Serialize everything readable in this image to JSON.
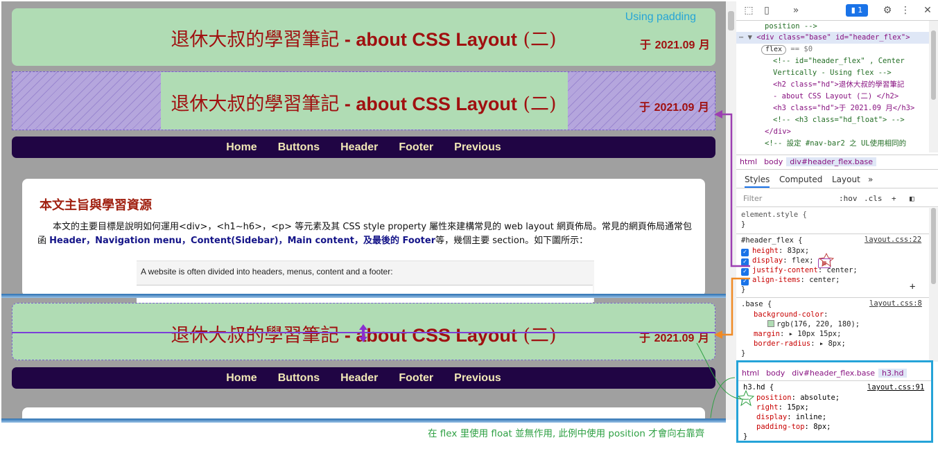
{
  "page": {
    "header1": {
      "title_zh": "退休大叔的學習筆記",
      "title_sep": " - ",
      "title_en": "about CSS Layout",
      "title_num": " (二)",
      "date_prefix": "于 ",
      "date_num": "2021.09",
      "date_suffix": " 月",
      "note": "Using padding"
    },
    "header2": {
      "title_zh": "退休大叔的學習筆記",
      "title_sep": " - ",
      "title_en": "about CSS Layout",
      "title_num": " (二)",
      "date_prefix": "于 ",
      "date_num": "2021.09",
      "date_suffix": " 月"
    },
    "header3": {
      "title_zh": "退休大叔的學習筆記",
      "title_sep": " - ",
      "title_en": "about CSS Layout",
      "title_num": " (二)",
      "date_prefix": "于 ",
      "date_num": "2021.09",
      "date_suffix": " 月"
    },
    "nav": [
      "Home",
      "Buttons",
      "Header",
      "Footer",
      "Previous"
    ],
    "card": {
      "heading": "本文主旨與學習資源",
      "para_1": "本文的主要目標是說明如何運用<div>，<h1~h6>，<p> 等元素及其 CSS style property 屬性來建構常見的 web layout 網頁佈局。常見的網頁佈局通常包函 ",
      "para_hl": "Header，Navigation menu，Content(Sidebar)，Main content，及最後的 Footer",
      "para_2": "等，幾個主要 section。如下圖所示：",
      "inner_caption": "A website is often divided into headers, menus, content and a footer:"
    }
  },
  "devtools": {
    "dom": [
      "position -->",
      "<div class=\"base\" id=\"header_flex\">",
      "flex == $0",
      "<!-- id=\"header_flex\" , Center",
      "Vertically - Using flex -->",
      "<h2 class=\"hd\">退休大叔的學習筆記",
      "- about CSS Layout (二) </h2>",
      "<h3 class=\"hd\">于 2021.09 月</h3>",
      "<!-- <h3 class=\"hd_float\"> -->",
      "</div>",
      "<!-- 設定 #nav-bar2 之 UL使用相同的"
    ],
    "crumbs": [
      "html",
      "body",
      "div#header_flex.base"
    ],
    "tabs": [
      "Styles",
      "Computed",
      "Layout"
    ],
    "filter_placeholder": "Filter",
    "filter_hov": ":hov",
    "filter_cls": ".cls",
    "badge": "1",
    "styles": {
      "element_style": "element.style {",
      "rule1_sel": "#header_flex {",
      "rule1_src": "layout.css:22",
      "rule1_props": [
        {
          "name": "height",
          "value": "83px;"
        },
        {
          "name": "display",
          "value": "flex;"
        },
        {
          "name": "justify-content",
          "value": "center;"
        },
        {
          "name": "align-items",
          "value": "center;"
        }
      ],
      "rule2_sel": ".base {",
      "rule2_src": "layout.css:8",
      "rule2_props": [
        {
          "name": "background-color",
          "value": ""
        },
        {
          "name": "",
          "value": "rgb(176, 220, 180);"
        },
        {
          "name": "margin",
          "value": "10px 15px;"
        },
        {
          "name": "border-radius",
          "value": "8px;"
        }
      ]
    },
    "callout": {
      "crumbs": [
        "html",
        "body",
        "div#header_flex.base",
        "h3.hd"
      ],
      "sel": "h3.hd {",
      "src": "layout.css:91",
      "props": [
        {
          "name": "position",
          "value": "absolute;"
        },
        {
          "name": "right",
          "value": "15px;"
        },
        {
          "name": "display",
          "value": "inline;"
        },
        {
          "name": "padding-top",
          "value": "8px;"
        }
      ]
    }
  },
  "footnote": "在 flex 里使用 float 並無作用, 此例中使用 position 才會向右靠齊",
  "colors": {
    "green": "#b0dcb4",
    "nav": "#200544",
    "accent_purple": "#9c3fb2",
    "accent_orange": "#f08a24",
    "callout_blue": "#25a3d8"
  }
}
